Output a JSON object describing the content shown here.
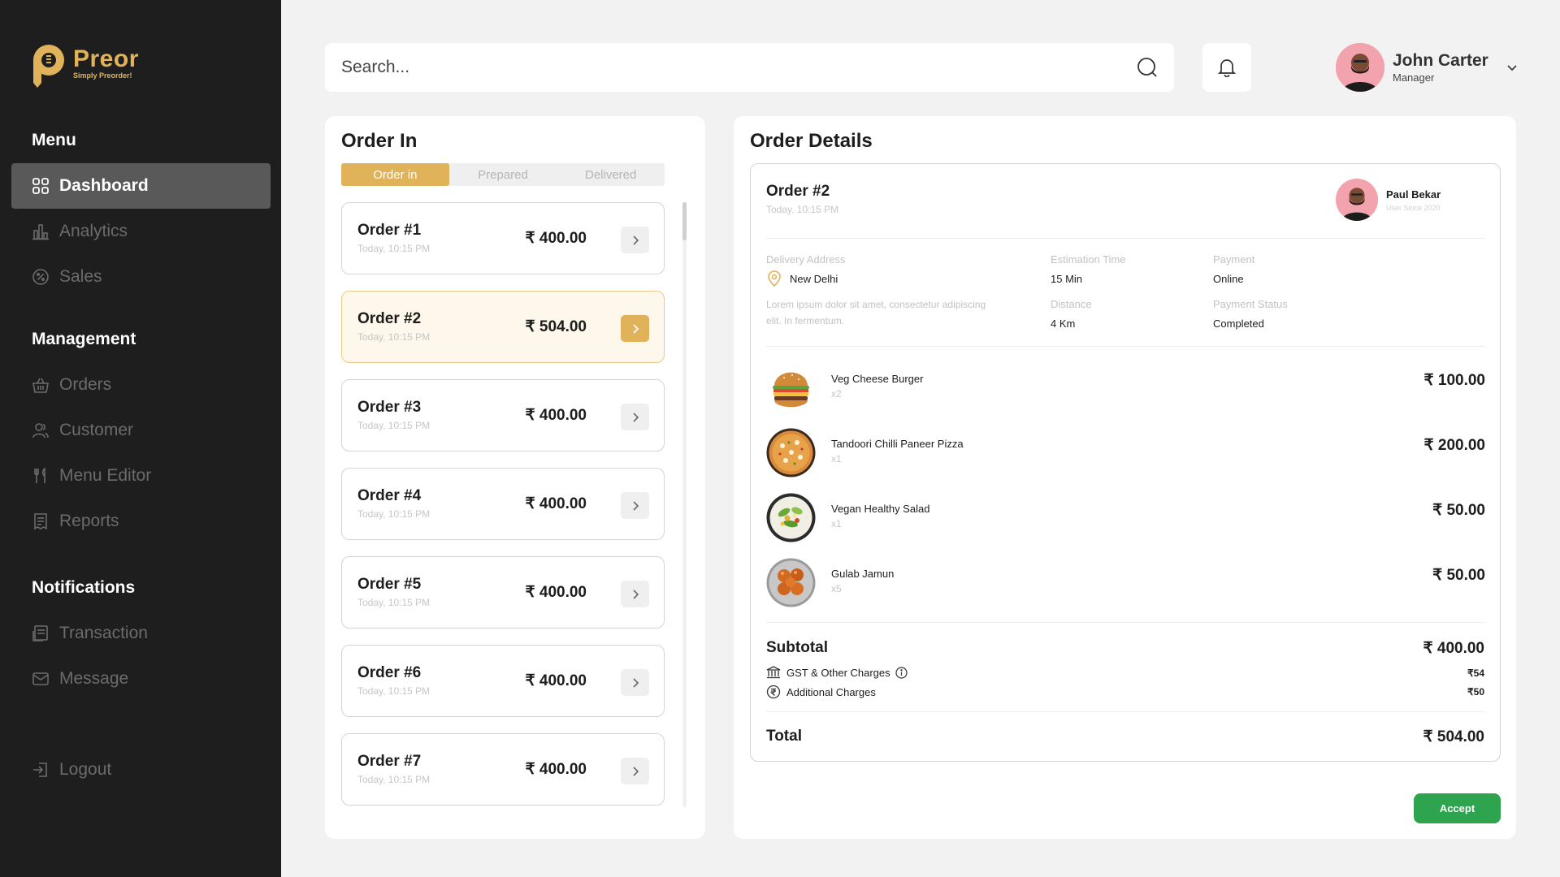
{
  "app": {
    "name": "Preor",
    "tagline": "Simply Preorder!"
  },
  "colors": {
    "accent": "#e0b35a",
    "sidebar": "#1e1e1e",
    "accept": "#2ea44f"
  },
  "sidebar": {
    "menu_title": "Menu",
    "menu_items": [
      {
        "label": "Dashboard",
        "icon": "grid-icon",
        "active": true
      },
      {
        "label": "Analytics",
        "icon": "bar-chart-icon"
      },
      {
        "label": "Sales",
        "icon": "percent-icon"
      }
    ],
    "management_title": "Management",
    "management_items": [
      {
        "label": "Orders",
        "icon": "basket-icon"
      },
      {
        "label": "Customer",
        "icon": "users-icon"
      },
      {
        "label": "Menu Editor",
        "icon": "fork-knife-icon"
      },
      {
        "label": "Reports",
        "icon": "receipt-icon"
      }
    ],
    "notifications_title": "Notifications",
    "notification_items": [
      {
        "label": "Transaction",
        "icon": "transaction-icon"
      },
      {
        "label": "Message",
        "icon": "mail-icon"
      }
    ],
    "logout_label": "Logout"
  },
  "header": {
    "search_placeholder": "Search...",
    "user": {
      "name": "John Carter",
      "role": "Manager"
    }
  },
  "order_in": {
    "title": "Order In",
    "tabs": [
      {
        "label": "Order in",
        "active": true
      },
      {
        "label": "Prepared"
      },
      {
        "label": "Delivered"
      }
    ],
    "orders": [
      {
        "title": "Order #1",
        "time": "Today, 10:15 PM",
        "amount": "₹ 400.00"
      },
      {
        "title": "Order #2",
        "time": "Today, 10:15 PM",
        "amount": "₹ 504.00",
        "selected": true
      },
      {
        "title": "Order #3",
        "time": "Today, 10:15 PM",
        "amount": "₹ 400.00"
      },
      {
        "title": "Order #4",
        "time": "Today, 10:15 PM",
        "amount": "₹ 400.00"
      },
      {
        "title": "Order #5",
        "time": "Today, 10:15 PM",
        "amount": "₹ 400.00"
      },
      {
        "title": "Order #6",
        "time": "Today, 10:15 PM",
        "amount": "₹ 400.00"
      },
      {
        "title": "Order #7",
        "time": "Today, 10:15 PM",
        "amount": "₹ 400.00"
      }
    ]
  },
  "order_details": {
    "title": "Order Details",
    "order": "Order #2",
    "time": "Today, 10:15 PM",
    "customer": {
      "name": "Paul Bekar",
      "since": "User Since 2020"
    },
    "delivery_address_label": "Delivery Address",
    "delivery_address": "New Delhi",
    "address_desc": "Lorem ipsum dolor sit amet, consectetur adipiscing elit. In fermentum.",
    "estimation_label": "Estimation Time",
    "estimation": "15 Min",
    "distance_label": "Distance",
    "distance": "4 Km",
    "payment_label": "Payment",
    "payment": "Online",
    "payment_status_label": "Payment Status",
    "payment_status": "Completed",
    "items": [
      {
        "name": "Veg Cheese Burger",
        "qty": "x2",
        "price": "₹ 100.00",
        "image": "burger-image"
      },
      {
        "name": "Tandoori Chilli Paneer Pizza",
        "qty": "x1",
        "price": "₹ 200.00",
        "image": "pizza-image"
      },
      {
        "name": "Vegan Healthy Salad",
        "qty": "x1",
        "price": "₹ 50.00",
        "image": "salad-image"
      },
      {
        "name": "Gulab Jamun",
        "qty": "x5",
        "price": "₹ 50.00",
        "image": "gulab-jamun-image"
      }
    ],
    "subtotal_label": "Subtotal",
    "subtotal": "₹ 400.00",
    "gst_label": "GST & Other Charges",
    "gst": "₹54",
    "additional_label": "Additional Charges",
    "additional": "₹50",
    "total_label": "Total",
    "total": "₹ 504.00",
    "accept_label": "Accept"
  }
}
